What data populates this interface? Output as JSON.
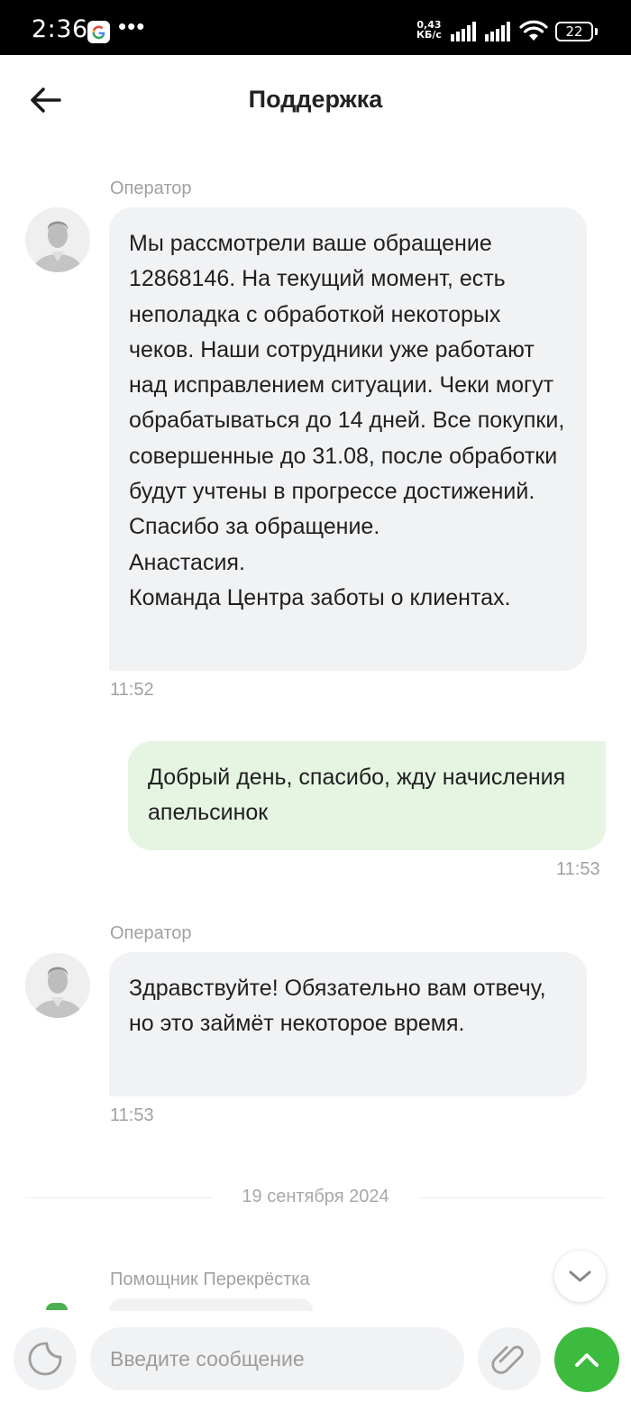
{
  "status_bar": {
    "time": "2:36",
    "dots": "•••",
    "net_speed_value": "0,43",
    "net_speed_unit": "КБ/с",
    "battery": "22"
  },
  "header": {
    "title": "Поддержка",
    "back_icon": "arrow-left-icon"
  },
  "messages": [
    {
      "sender": "Оператор",
      "text": "Мы рассмотрели ваше обращение 12868146. На текущий момент, есть неполадка с обработкой некоторых чеков. Наши сотрудники уже работают над исправлением ситуации. Чеки могут обрабатываться до 14 дней. Все покупки, совершенные до 31.08, после обработки будут учтены в прогрессе достижений. Спасибо за обращение.\nАнастасия.\nКоманда Центра заботы о клиентах.",
      "time": "11:52"
    },
    {
      "sender": "",
      "text": "Добрый день, спасибо, жду начисления апельсинок",
      "time": "11:53"
    },
    {
      "sender": "Оператор",
      "text": "Здравствуйте! Обязательно вам отвечу, но это займёт некоторое время.",
      "time": "11:53"
    }
  ],
  "date_separator": "19 сентября 2024",
  "next_sender": "Помощник Перекрёстка",
  "input": {
    "placeholder": "Введите сообщение"
  },
  "colors": {
    "accent_green": "#3dbb3e",
    "own_bubble": "#e6f4e2",
    "operator_bubble": "#f1f2f4"
  },
  "icons": {
    "sticker": "sticker-icon",
    "attach": "paperclip-icon",
    "send": "chevron-up-icon",
    "scroll_down": "chevron-down-icon"
  }
}
